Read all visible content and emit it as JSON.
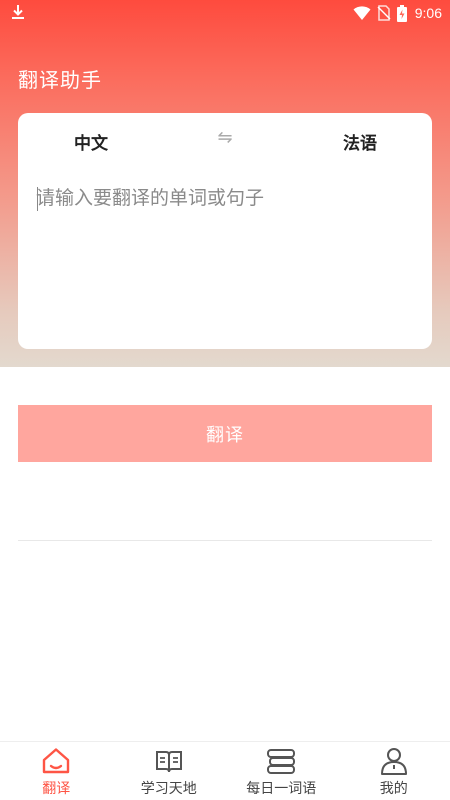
{
  "status_bar": {
    "time": "9:06"
  },
  "header": {
    "title": "翻译助手"
  },
  "translator": {
    "source_lang": "中文",
    "target_lang": "法语",
    "swap_icon": "swap-arrows-icon",
    "input_placeholder": "请输入要翻译的单词或句子",
    "input_value": "",
    "translate_label": "翻译"
  },
  "bottom_nav": {
    "items": [
      {
        "label": "翻译",
        "icon": "home-icon",
        "active": true
      },
      {
        "label": "学习天地",
        "icon": "book-icon",
        "active": false
      },
      {
        "label": "每日一词语",
        "icon": "books-stack-icon",
        "active": false
      },
      {
        "label": "我的",
        "icon": "user-icon",
        "active": false
      }
    ]
  },
  "colors": {
    "accent": "#fe4b3e",
    "button": "#ffa69e",
    "active_nav": "#fe5545"
  }
}
